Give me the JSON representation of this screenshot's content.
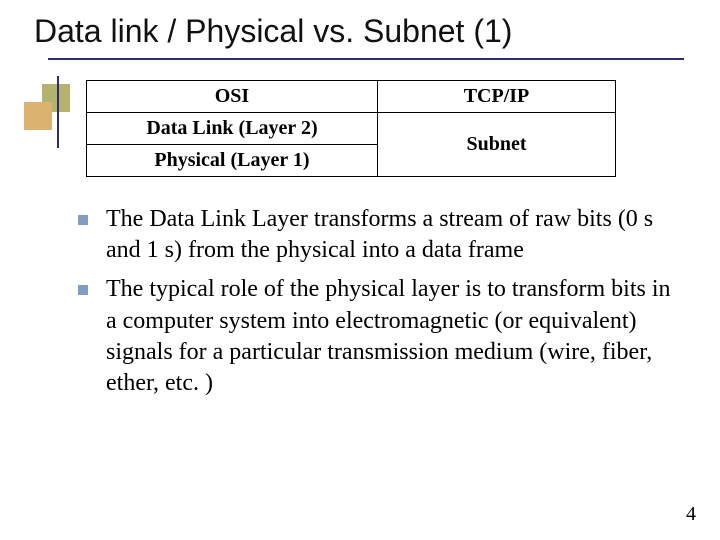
{
  "title": "Data link / Physical vs. Subnet (1)",
  "table": {
    "headers": {
      "left": "OSI",
      "right": "TCP/IP"
    },
    "rows": [
      {
        "left": "Data Link (Layer 2)",
        "right": "Subnet"
      },
      {
        "left": "Physical (Layer 1)"
      }
    ]
  },
  "bullets": [
    "The Data Link Layer transforms a stream of raw bits (0 s and 1 s) from the physical into a data frame",
    "The typical role of the physical layer is to transform bits in a computer system into electromagnetic (or equivalent) signals for a particular transmission medium (wire, fiber, ether, etc. )"
  ],
  "page_number": "4"
}
